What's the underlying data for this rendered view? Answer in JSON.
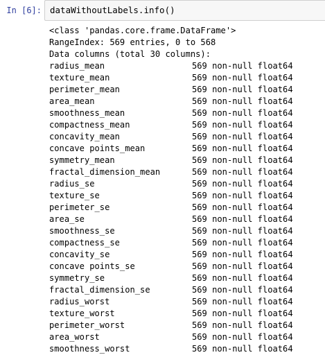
{
  "cell": {
    "prompt": "In [6]:",
    "code": "dataWithoutLabels.info()"
  },
  "output": {
    "header_lines": [
      "<class 'pandas.core.frame.DataFrame'>",
      "RangeIndex: 569 entries, 0 to 568",
      "Data columns (total 30 columns):"
    ],
    "columns": [
      {
        "name": "radius_mean",
        "info": "569 non-null float64"
      },
      {
        "name": "texture_mean",
        "info": "569 non-null float64"
      },
      {
        "name": "perimeter_mean",
        "info": "569 non-null float64"
      },
      {
        "name": "area_mean",
        "info": "569 non-null float64"
      },
      {
        "name": "smoothness_mean",
        "info": "569 non-null float64"
      },
      {
        "name": "compactness_mean",
        "info": "569 non-null float64"
      },
      {
        "name": "concavity_mean",
        "info": "569 non-null float64"
      },
      {
        "name": "concave points_mean",
        "info": "569 non-null float64"
      },
      {
        "name": "symmetry_mean",
        "info": "569 non-null float64"
      },
      {
        "name": "fractal_dimension_mean",
        "info": "569 non-null float64"
      },
      {
        "name": "radius_se",
        "info": "569 non-null float64"
      },
      {
        "name": "texture_se",
        "info": "569 non-null float64"
      },
      {
        "name": "perimeter_se",
        "info": "569 non-null float64"
      },
      {
        "name": "area_se",
        "info": "569 non-null float64"
      },
      {
        "name": "smoothness_se",
        "info": "569 non-null float64"
      },
      {
        "name": "compactness_se",
        "info": "569 non-null float64"
      },
      {
        "name": "concavity_se",
        "info": "569 non-null float64"
      },
      {
        "name": "concave points_se",
        "info": "569 non-null float64"
      },
      {
        "name": "symmetry_se",
        "info": "569 non-null float64"
      },
      {
        "name": "fractal_dimension_se",
        "info": "569 non-null float64"
      },
      {
        "name": "radius_worst",
        "info": "569 non-null float64"
      },
      {
        "name": "texture_worst",
        "info": "569 non-null float64"
      },
      {
        "name": "perimeter_worst",
        "info": "569 non-null float64"
      },
      {
        "name": "area_worst",
        "info": "569 non-null float64"
      },
      {
        "name": "smoothness_worst",
        "info": "569 non-null float64"
      }
    ]
  }
}
